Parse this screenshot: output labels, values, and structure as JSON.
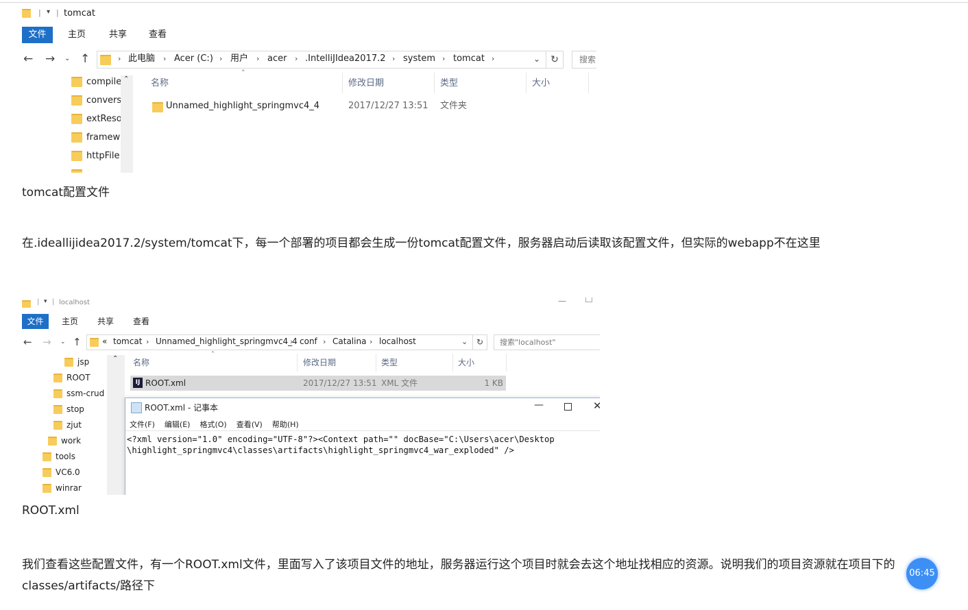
{
  "shot1": {
    "title": "tomcat",
    "tabs": [
      "文件",
      "主页",
      "共享",
      "查看"
    ],
    "breadcrumbs": [
      "此电脑",
      "Acer (C:)",
      "用户",
      "acer",
      ".IntelliJIdea2017.2",
      "system",
      "tomcat"
    ],
    "search_placeholder": "搜索",
    "tree": [
      "compile",
      "convers",
      "extReso",
      "framew",
      "httpFile"
    ],
    "columns": {
      "name": "名称",
      "modified": "修改日期",
      "type": "类型",
      "size": "大小"
    },
    "rows": [
      {
        "name": "Unnamed_highlight_springmvc4_4",
        "modified": "2017/12/27 13:51",
        "type": "文件夹",
        "size": ""
      }
    ]
  },
  "caption1": "tomcat配置文件",
  "para1": "在.ideallijidea2017.2/system/tomcat下，每一个部署的项目都会生成一份tomcat配置文件，服务器启动后读取该配置文件，但实际的webapp不在这里",
  "shot2": {
    "title": "localhost",
    "tabs": [
      "文件",
      "主页",
      "共享",
      "查看"
    ],
    "breadcrumb_prefix": "«",
    "breadcrumbs": [
      "tomcat",
      "Unnamed_highlight_springmvc4_4",
      "conf",
      "Catalina",
      "localhost"
    ],
    "search_placeholder": "搜索\"localhost\"",
    "tree": [
      "jsp",
      "ROOT",
      "ssm-crud",
      "stop",
      "zjut",
      "work",
      "tools",
      "VC6.0",
      "winrar"
    ],
    "columns": {
      "name": "名称",
      "modified": "修改日期",
      "type": "类型",
      "size": "大小"
    },
    "rows": [
      {
        "name": "ROOT.xml",
        "modified": "2017/12/27 13:51",
        "type": "XML 文件",
        "size": "1 KB"
      }
    ],
    "notepad": {
      "title": "ROOT.xml - 记事本",
      "menu": [
        "文件(F)",
        "编辑(E)",
        "格式(O)",
        "查看(V)",
        "帮助(H)"
      ],
      "lines": [
        "<?xml version=\"1.0\" encoding=\"UTF-8\"?><Context path=\"\" docBase=\"C:\\Users\\acer\\Desktop",
        "\\highlight_springmvc4\\classes\\artifacts\\highlight_springmvc4_war_exploded\" />"
      ]
    }
  },
  "caption2": "ROOT.xml",
  "para2_line1": "我们查看这些配置文件，有一个ROOT.xml文件，里面写入了该项目文件的地址，服务器运行这个项目时就会去这个地址找相应的资源。说明我们的项目资源就在项目下的",
  "para2_line2": "classes/artifacts/路径下",
  "timer": "06:45",
  "colors": {
    "accent": "#1e6fc7",
    "timer_bg": "#3d8ff5"
  }
}
